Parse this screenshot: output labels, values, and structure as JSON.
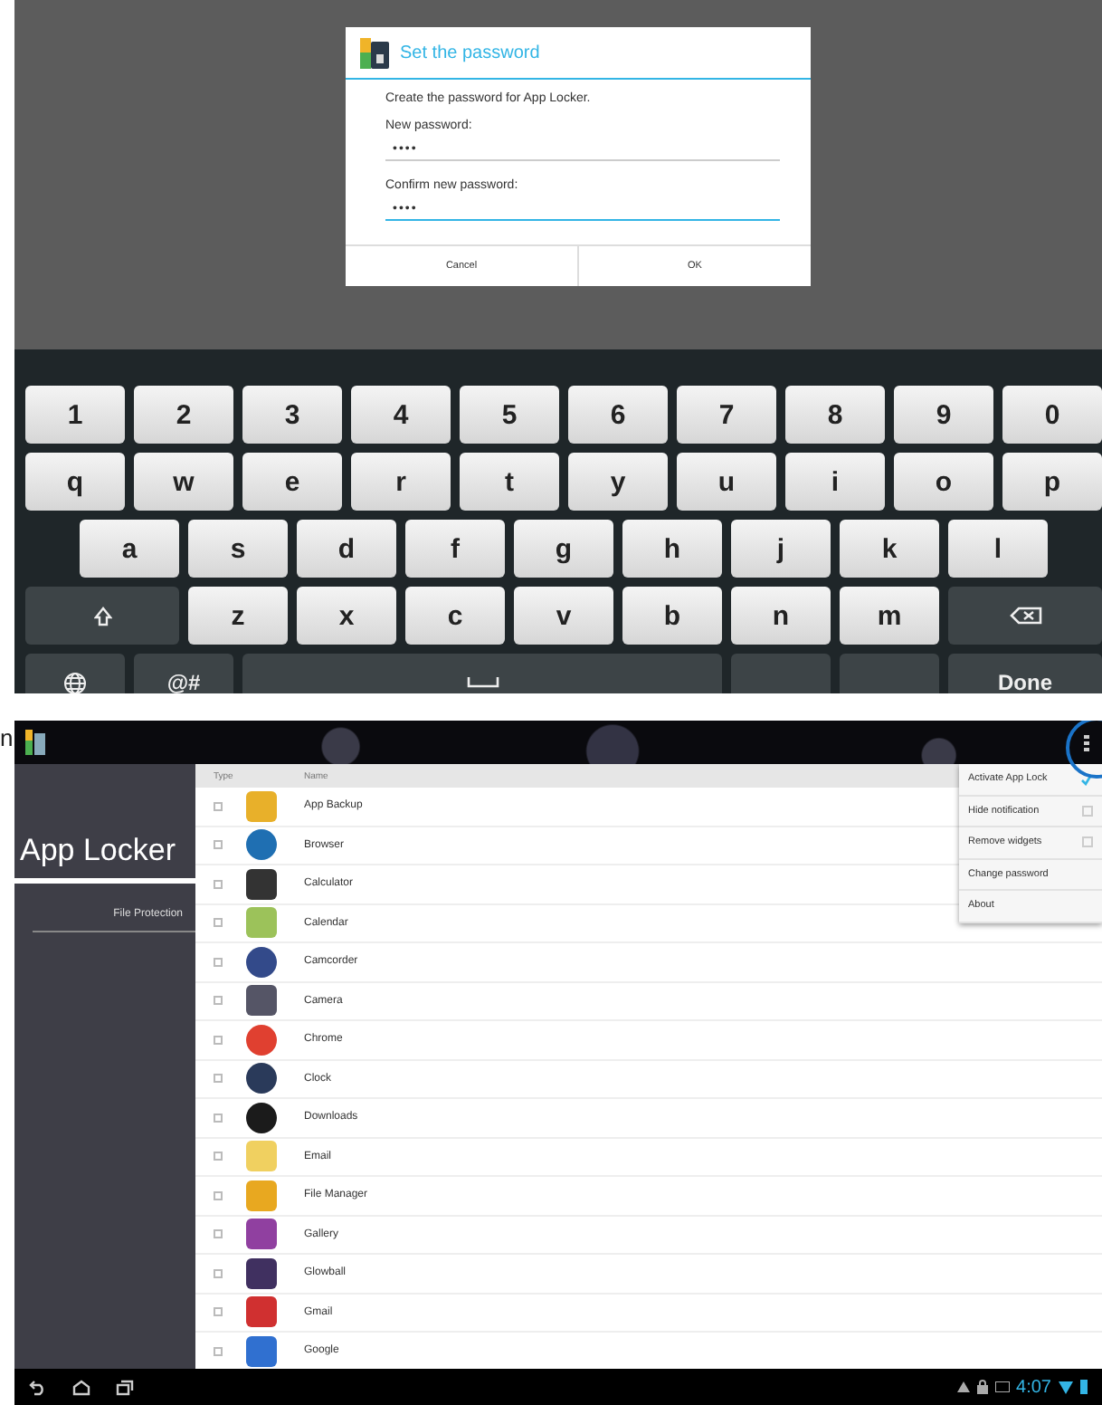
{
  "stray_text": "n",
  "password_dialog": {
    "title": "Set the password",
    "message": "Create the password for App Locker.",
    "fields": [
      {
        "label": "New password:",
        "value": "••••",
        "focused": false
      },
      {
        "label": "Confirm new password:",
        "value": "••••",
        "focused": true
      }
    ],
    "buttons": [
      "Cancel",
      "OK"
    ]
  },
  "keyboard": {
    "rows": [
      [
        {
          "kind": "char",
          "label": "1"
        },
        {
          "kind": "char",
          "label": "2"
        },
        {
          "kind": "char",
          "label": "3"
        },
        {
          "kind": "char",
          "label": "4"
        },
        {
          "kind": "char",
          "label": "5"
        },
        {
          "kind": "char",
          "label": "6"
        },
        {
          "kind": "char",
          "label": "7"
        },
        {
          "kind": "char",
          "label": "8"
        },
        {
          "kind": "char",
          "label": "9"
        },
        {
          "kind": "char",
          "label": "0"
        }
      ],
      [
        {
          "kind": "char",
          "label": "q"
        },
        {
          "kind": "char",
          "label": "w"
        },
        {
          "kind": "char",
          "label": "e"
        },
        {
          "kind": "char",
          "label": "r"
        },
        {
          "kind": "char",
          "label": "t"
        },
        {
          "kind": "char",
          "label": "y"
        },
        {
          "kind": "char",
          "label": "u"
        },
        {
          "kind": "char",
          "label": "i"
        },
        {
          "kind": "char",
          "label": "o"
        },
        {
          "kind": "char",
          "label": "p"
        }
      ],
      [
        {
          "kind": "char",
          "label": "a"
        },
        {
          "kind": "char",
          "label": "s"
        },
        {
          "kind": "char",
          "label": "d"
        },
        {
          "kind": "char",
          "label": "f"
        },
        {
          "kind": "char",
          "label": "g"
        },
        {
          "kind": "char",
          "label": "h"
        },
        {
          "kind": "char",
          "label": "j"
        },
        {
          "kind": "char",
          "label": "k"
        },
        {
          "kind": "char",
          "label": "l"
        }
      ],
      [
        {
          "kind": "shift"
        },
        {
          "kind": "char",
          "label": "z"
        },
        {
          "kind": "char",
          "label": "x"
        },
        {
          "kind": "char",
          "label": "c"
        },
        {
          "kind": "char",
          "label": "v"
        },
        {
          "kind": "char",
          "label": "b"
        },
        {
          "kind": "char",
          "label": "n"
        },
        {
          "kind": "char",
          "label": "m"
        },
        {
          "kind": "backspace"
        }
      ],
      [
        {
          "kind": "globe"
        },
        {
          "kind": "func",
          "label": "@#"
        },
        {
          "kind": "space"
        },
        {
          "kind": "func"
        },
        {
          "kind": "func"
        },
        {
          "kind": "func",
          "label": "Done"
        }
      ]
    ]
  },
  "app_locker": {
    "title": "App Locker",
    "sidebar_items": [
      {
        "label": "File Protection",
        "selected": false
      }
    ],
    "columns": [
      "Type",
      "Name"
    ],
    "apps": [
      {
        "name": "App Backup",
        "checked": false
      },
      {
        "name": "Browser",
        "checked": false
      },
      {
        "name": "Calculator",
        "checked": false
      },
      {
        "name": "Calendar",
        "checked": false
      },
      {
        "name": "Camcorder",
        "checked": false
      },
      {
        "name": "Camera",
        "checked": false
      },
      {
        "name": "Chrome",
        "checked": false
      },
      {
        "name": "Clock",
        "checked": false
      },
      {
        "name": "Downloads",
        "checked": false
      },
      {
        "name": "Email",
        "checked": false
      },
      {
        "name": "File Manager",
        "checked": false
      },
      {
        "name": "Gallery",
        "checked": false
      },
      {
        "name": "Glowball",
        "checked": false
      },
      {
        "name": "Gmail",
        "checked": false
      },
      {
        "name": "Google",
        "checked": false
      }
    ],
    "menu": [
      {
        "kind": "check",
        "label": "Activate App Lock",
        "checked": true
      },
      {
        "kind": "check",
        "label": "Hide notification",
        "checked": false
      },
      {
        "kind": "check",
        "label": "Remove widgets",
        "checked": false
      },
      {
        "kind": "plain",
        "label": "Change password"
      },
      {
        "kind": "plain",
        "label": "About"
      }
    ],
    "status_bar": {
      "time": "4:07"
    }
  }
}
